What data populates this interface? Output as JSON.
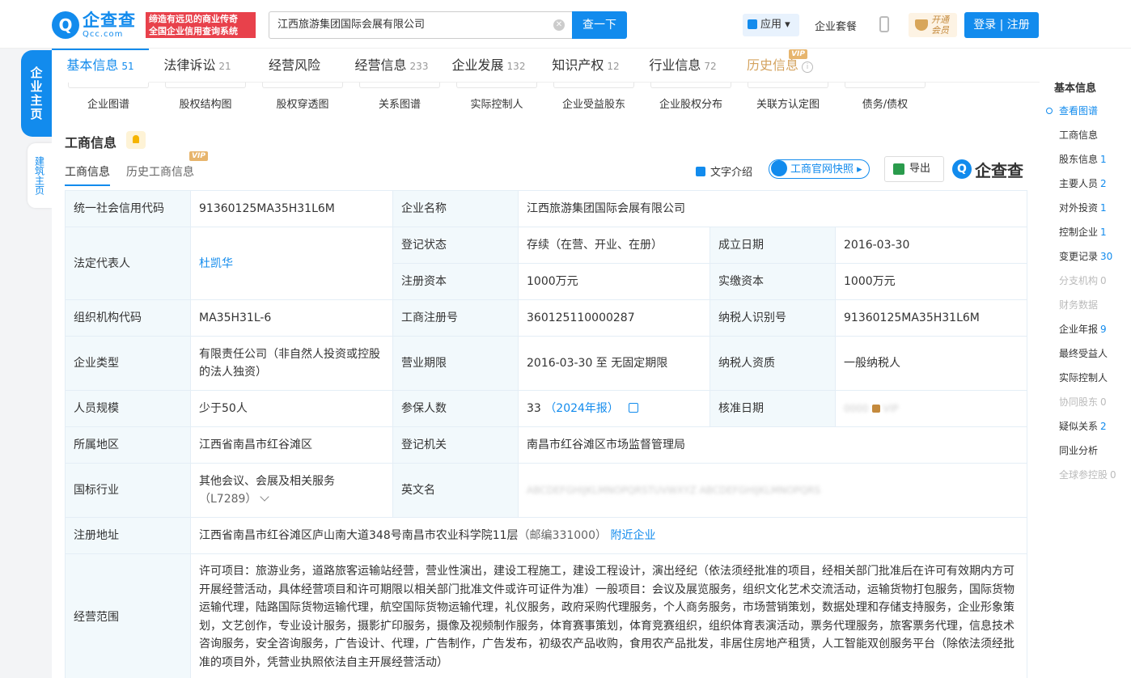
{
  "header": {
    "logo_mark": "Q",
    "logo_main": "企查查",
    "logo_sub": "Qcc.com",
    "slogan_line1": "缔造有远见的商业传奇",
    "slogan_line2": "全国企业信用查询系统",
    "search_value": "江西旅游集团国际会展有限公司",
    "search_button": "查一下",
    "apps_label": "应用",
    "package_label": "企业套餐",
    "vip_line1": "开通",
    "vip_line2": "会员",
    "login_label": "登录 | 注册"
  },
  "left_nav": {
    "primary": "企业主页",
    "secondary": "建筑主页"
  },
  "tabs": [
    {
      "label": "基本信息",
      "count": "51"
    },
    {
      "label": "法律诉讼",
      "count": "21"
    },
    {
      "label": "经营风险",
      "count": ""
    },
    {
      "label": "经营信息",
      "count": "233"
    },
    {
      "label": "企业发展",
      "count": "132"
    },
    {
      "label": "知识产权",
      "count": "12"
    },
    {
      "label": "行业信息",
      "count": "72"
    },
    {
      "label": "历史信息",
      "count": "",
      "badge": "VIP"
    }
  ],
  "subnav": [
    "企业图谱",
    "股权结构图",
    "股权穿透图",
    "关系图谱",
    "实际控制人",
    "企业受益股东",
    "企业股权分布",
    "关联方认定图",
    "债务/债权"
  ],
  "section": {
    "title": "工商信息",
    "tab_current": "工商信息",
    "tab_history": "历史工商信息",
    "tab_history_badge": "VIP",
    "text_intro": "文字介绍",
    "snapshot": "工商官网快照",
    "export": "导出",
    "brand": "企查查",
    "brand_mark": "Q"
  },
  "info": {
    "credit_code_k": "统一社会信用代码",
    "credit_code_v": "91360125MA35H31L6M",
    "name_k": "企业名称",
    "name_v": "江西旅游集团国际会展有限公司",
    "legal_k": "法定代表人",
    "legal_v": "杜凯华",
    "status_k": "登记状态",
    "status_v": "存续（在营、开业、在册）",
    "found_k": "成立日期",
    "found_v": "2016-03-30",
    "capital_k": "注册资本",
    "capital_v": "1000万元",
    "paid_k": "实缴资本",
    "paid_v": "1000万元",
    "org_k": "组织机构代码",
    "org_v": "MA35H31L-6",
    "regno_k": "工商注册号",
    "regno_v": "360125110000287",
    "taxid_k": "纳税人识别号",
    "taxid_v": "91360125MA35H31L6M",
    "type_k": "企业类型",
    "type_v": "有限责任公司（非自然人投资或控股的法人独资）",
    "term_k": "营业期限",
    "term_v": "2016-03-30 至 无固定期限",
    "taxq_k": "纳税人资质",
    "taxq_v": "一般纳税人",
    "staff_k": "人员规模",
    "staff_v": "少于50人",
    "insured_k": "参保人数",
    "insured_v": "33",
    "insured_note": "（2024年报）",
    "approve_k": "核准日期",
    "approve_v": "VIP",
    "region_k": "所属地区",
    "region_v": "江西省南昌市红谷滩区",
    "authority_k": "登记机关",
    "authority_v": "南昌市红谷滩区市场监督管理局",
    "industry_k": "国标行业",
    "industry_v": "其他会议、会展及相关服务",
    "industry_code": "（L7289）",
    "english_k": "英文名",
    "english_v": "ABCDEFGHIJKLMNOPQRSTUVWXYZ ABCDEFGHIJKLMNOPQRS",
    "address_k": "注册地址",
    "address_v": "江西省南昌市红谷滩区庐山南大道348号南昌市农业科学院11层",
    "address_zip": "（邮编331000）",
    "address_near": "附近企业",
    "scope_k": "经营范围",
    "scope_v": "许可项目：旅游业务，道路旅客运输站经营，营业性演出，建设工程施工，建设工程设计，演出经纪（依法须经批准的项目，经相关部门批准后在许可有效期内方可开展经营活动，具体经营项目和许可期限以相关部门批准文件或许可证件为准）一般项目：会议及展览服务，组织文化艺术交流活动，运输货物打包服务，国际货物运输代理，陆路国际货物运输代理，航空国际货物运输代理，礼仪服务，政府采购代理服务，个人商务服务，市场营销策划，数据处理和存储支持服务，企业形象策划，文艺创作，专业设计服务，摄影扩印服务，摄像及视频制作服务，体育赛事策划，体育竞赛组织，组织体育表演活动，票务代理服务，旅客票务代理，信息技术咨询服务，安全咨询服务，广告设计、代理，广告制作，广告发布，初级农产品收购，食用农产品批发，非居住房地产租赁，人工智能双创服务平台（除依法须经批准的项目外，凭营业执照依法自主开展经营活动）"
  },
  "right_nav": {
    "title": "基本信息",
    "items": [
      {
        "label": "查看图谱",
        "count": ""
      },
      {
        "label": "工商信息",
        "count": ""
      },
      {
        "label": "股东信息",
        "count": "1"
      },
      {
        "label": "主要人员",
        "count": "2"
      },
      {
        "label": "对外投资",
        "count": "1"
      },
      {
        "label": "控制企业",
        "count": "1"
      },
      {
        "label": "变更记录",
        "count": "30"
      },
      {
        "label": "分支机构",
        "count": "0"
      },
      {
        "label": "财务数据",
        "count": ""
      },
      {
        "label": "企业年报",
        "count": "9"
      },
      {
        "label": "最终受益人",
        "count": ""
      },
      {
        "label": "实际控制人",
        "count": ""
      },
      {
        "label": "协同股东",
        "count": "0"
      },
      {
        "label": "疑似关系",
        "count": "2"
      },
      {
        "label": "同业分析",
        "count": ""
      },
      {
        "label": "全球参控股",
        "count": "0"
      }
    ]
  }
}
